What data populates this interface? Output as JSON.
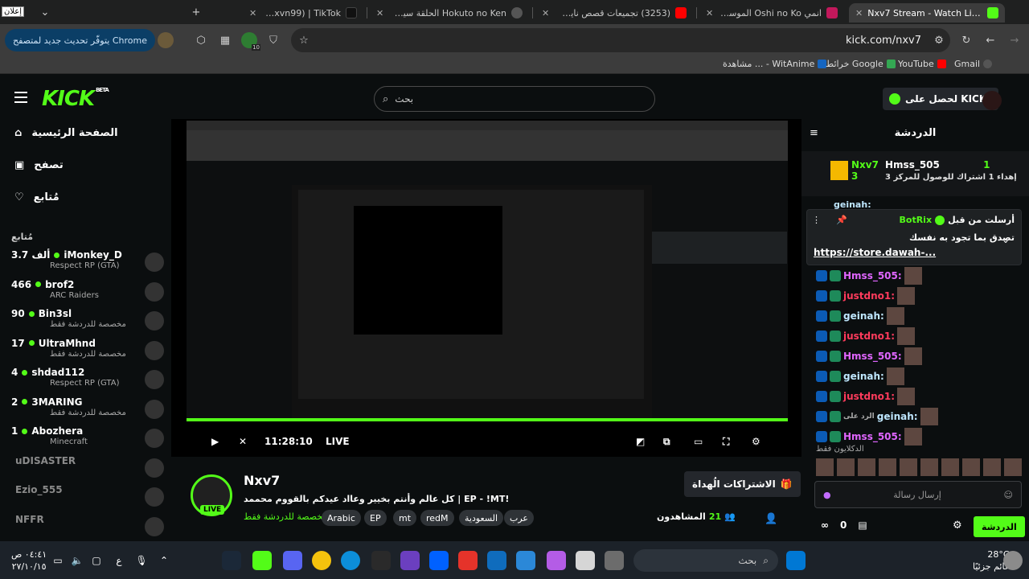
{
  "browser": {
    "tabs": [
      {
        "title": "Nxv7 Stream - Watch Live on Kick",
        "active": true
      },
      {
        "title": "انمي Oshi no Ko الموسم 3 الحلقة",
        "active": false
      },
      {
        "title": "(3253) تجميعات قصص نايف حمد",
        "active": false
      },
      {
        "title": "Hokuto no Ken الحلقة سيف النار",
        "active": false
      },
      {
        "title": "NV (@nxvn99) | TikTok",
        "active": false
      }
    ],
    "notice_label": "إعلان",
    "address": "kick.com/nxv7",
    "update_label": "يتوفّر تحديث جديد لمتصفح Chrome",
    "extension_badge": "10",
    "bookmarks": [
      "Gmail",
      "YouTube",
      "خرائط Google",
      "مشاهدة ... - WitAnime"
    ]
  },
  "header": {
    "logo": "KICK",
    "logo_beta": "BETA",
    "search_placeholder": "بحث",
    "get_kicks_label": "لحصل على KICKs"
  },
  "sidebar": {
    "nav": [
      {
        "label": "الصفحة الرئيسية",
        "icon": "home-icon"
      },
      {
        "label": "تصفح",
        "icon": "browse-icon"
      },
      {
        "label": "مُتابع",
        "icon": "heart-icon"
      }
    ],
    "following_title": "مُتابع",
    "channels": [
      {
        "viewers": "3.7 ألف",
        "name": "iMonkey_D",
        "category": "Respect RP (GTA)",
        "live": true
      },
      {
        "viewers": "466",
        "name": "brof2",
        "category": "ARC Raiders",
        "live": true
      },
      {
        "viewers": "90",
        "name": "Bin3sl",
        "category": "مخصصة للدردشة فقط",
        "live": true
      },
      {
        "viewers": "17",
        "name": "UltraMhnd",
        "category": "مخصصة للدردشة فقط",
        "live": true
      },
      {
        "viewers": "4",
        "name": "shdad112",
        "category": "Respect RP (GTA)",
        "live": true
      },
      {
        "viewers": "2",
        "name": "3MARING",
        "category": "مخصصة للدردشة فقط",
        "live": true
      },
      {
        "viewers": "1",
        "name": "Abozhera",
        "category": "Minecraft",
        "live": true
      },
      {
        "viewers": "",
        "name": "uDISASTER",
        "category": "",
        "live": false
      },
      {
        "viewers": "",
        "name": "Ezio_555",
        "category": "",
        "live": false
      },
      {
        "viewers": "",
        "name": "NFFR",
        "category": "",
        "live": false
      }
    ]
  },
  "player": {
    "time": "11:28:10",
    "live_label": "LIVE",
    "progress": 1.0
  },
  "stream": {
    "name": "Nxv7",
    "live_badge": "LIVE",
    "title": "كل عالم وأنتم بخيير وعااد عيدكم بالقووم محممد | EP - !MT!",
    "category": "مخصصة للدردشة فقط",
    "tags": [
      "Arabic",
      "EP",
      "mt",
      "redM",
      "السعودية",
      "عرب"
    ],
    "viewers_label": "المشاهدون",
    "viewers_count": "21",
    "subs_label": "الاشتراكات الُهداة"
  },
  "chat": {
    "title": "الدردشة",
    "gifter_left": {
      "name": "Nxv7",
      "count": "3"
    },
    "gifter_right": {
      "name": "Hmss_505",
      "sub": "إهداء 1 اشتراك للوصول للمركز 3",
      "count": "1"
    },
    "top_name": "geinah: ",
    "pinned": {
      "pinned_by": "أرسلت من قبل",
      "user": "BotRix",
      "text": "تصدق بما تجود به نفسك",
      "link": "https://store.dawah-..."
    },
    "messages": [
      {
        "user": "Hmss_505:",
        "color": "#e066ff"
      },
      {
        "user": "justdno1:",
        "color": "#ff3b5c"
      },
      {
        "user": "geinah:",
        "color": "#bfe7ff"
      },
      {
        "user": "justdno1:",
        "color": "#ff3b5c"
      },
      {
        "user": "Hmss_505:",
        "color": "#e066ff"
      },
      {
        "user": "geinah:",
        "color": "#bfe7ff"
      },
      {
        "user": "justdno1:",
        "color": "#ff3b5c"
      },
      {
        "user": "geinah:",
        "color": "#bfe7ff",
        "reply": "الرد على"
      },
      {
        "user": "Hmss_505:",
        "color": "#e066ff"
      }
    ],
    "mods_only": "الدكلايون فقط",
    "input_placeholder": "إرسال رسالة",
    "send_label": "الدردشة",
    "points": "0"
  },
  "taskbar": {
    "weather_temp": "28°C",
    "weather_desc": "غائم جزئيًا",
    "search_label": "بحث",
    "time": "٠٤:٤١ ص",
    "date": "٢٧/١٠/١٥",
    "lang": "ع"
  }
}
